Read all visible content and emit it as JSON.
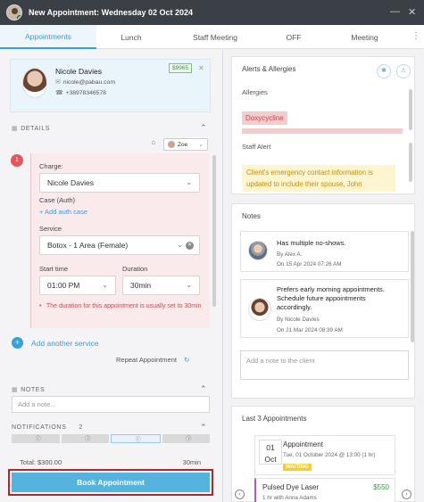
{
  "window": {
    "title": "New Appointment: Wednesday 02 Oct 2024",
    "minimize_icon": "minimize-icon",
    "close_icon": "close-icon"
  },
  "tabs": [
    {
      "label": "Appointments",
      "active": true
    },
    {
      "label": "Lunch"
    },
    {
      "label": "Staff Meeting"
    },
    {
      "label": "OFF"
    },
    {
      "label": "Meeting"
    }
  ],
  "client": {
    "name": "Nicole Davies",
    "email": "nicole@pabau.com",
    "phone": "+38978346578",
    "balance": "$9965"
  },
  "details": {
    "heading": "DETAILS",
    "staff": "Zoe",
    "service_number": "1",
    "charge_label": "Charge:",
    "charge_value": "Nicole Davies",
    "case_label": "Case (Auth)",
    "add_case": "+ Add auth case",
    "service_label": "Service",
    "service_value": "Botox - 1 Area (Female)",
    "start_label": "Start time",
    "start_value": "01:00 PM",
    "duration_label": "Duration",
    "duration_value": "30min",
    "warning": "The duration for this appointment is usually set to 30min",
    "add_service": "Add another service",
    "repeat": "Repeat Appointment"
  },
  "notes_section": {
    "heading": "NOTES",
    "placeholder": "Add a note..."
  },
  "notifications": {
    "heading": "NOTIFICATIONS",
    "count": "2"
  },
  "footer": {
    "total": "Total: $300.00",
    "duration": "30min",
    "book_label": "Book Appointment"
  },
  "alerts": {
    "title": "Alerts & Allergies",
    "allergies_label": "Allergies",
    "allergy_tag": "Doxycycline",
    "staff_alert_label": "Staff Alert",
    "staff_alert_text": "Client's emergency contact information is updated to include their spouse, John"
  },
  "notes_panel": {
    "title": "Notes",
    "items": [
      {
        "text": "Has multiple no-shows.",
        "by": "By Alex A.",
        "on": "On 15 Apr 2024 07:26 AM"
      },
      {
        "text": "Prefers early morning appointments. Schedule future appointments accordingly.",
        "by": "By Nicole Davies",
        "on": "On 21 Mar 2024 08:39 AM"
      }
    ],
    "add_placeholder": "Add a note to the client"
  },
  "last_appointments": {
    "title": "Last 3 Appointments",
    "items": [
      {
        "day": "01",
        "month": "Oct",
        "name": "Appointment",
        "when": "Tue, 01 October 2024 @ 13:00 (1 hr)",
        "status": "WAITING"
      },
      {
        "name": "Pulsed Dye Laser",
        "price": "$550",
        "detail": "1 hr with Anna Adams"
      }
    ]
  },
  "colors": {
    "accent": "#3a9ed8",
    "book_button": "#56b3dd",
    "highlight_frame": "#b0272c",
    "alert": "#e5555a"
  }
}
